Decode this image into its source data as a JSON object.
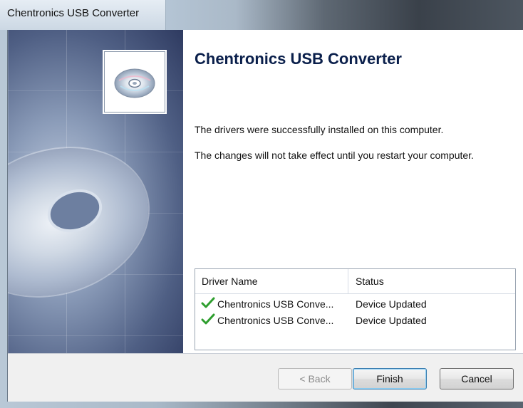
{
  "window": {
    "title": "Chentronics USB Converter"
  },
  "content": {
    "heading": "Chentronics USB Converter",
    "message_line1": "The drivers were successfully installed on this computer.",
    "message_line2": "The changes will not take effect until you restart your computer."
  },
  "driver_list": {
    "columns": [
      "Driver Name",
      "Status"
    ],
    "rows": [
      {
        "name": "Chentronics USB Conve...",
        "status": "Device Updated",
        "icon": "green-check-icon"
      },
      {
        "name": "Chentronics USB Conve...",
        "status": "Device Updated",
        "icon": "green-check-icon"
      }
    ]
  },
  "buttons": {
    "back_label": "< Back",
    "finish_label": "Finish",
    "cancel_label": "Cancel"
  },
  "colors": {
    "heading": "#0a1f4b",
    "check": "#2e9e2e",
    "default_button_border": "#3c7fb1"
  }
}
